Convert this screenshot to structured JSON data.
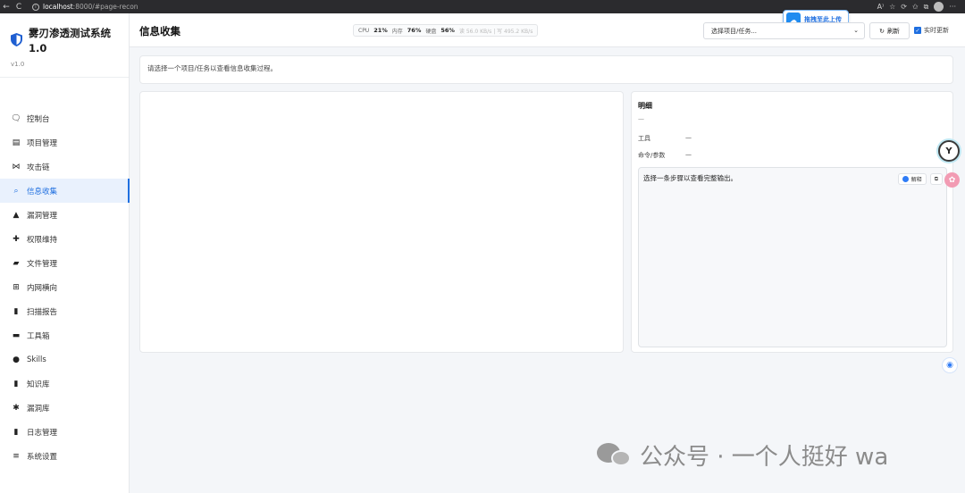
{
  "browser": {
    "url_host": "localhost",
    "url_path": ":8000/#page-recon",
    "back": "←",
    "reload": "C"
  },
  "brand": {
    "title": "雾刃渗透测试系统 1.0",
    "version": "v1.0"
  },
  "menu": [
    {
      "label": "控制台",
      "icon": "chat-icon",
      "glyph": "🗨"
    },
    {
      "label": "项目管理",
      "icon": "tree-icon",
      "glyph": "▤"
    },
    {
      "label": "攻击链",
      "icon": "chain-icon",
      "glyph": "⋈"
    },
    {
      "label": "信息收集",
      "icon": "search-icon",
      "glyph": "⌕",
      "active": true
    },
    {
      "label": "漏洞管理",
      "icon": "warning-icon",
      "glyph": "▲"
    },
    {
      "label": "权限维持",
      "icon": "pin-icon",
      "glyph": "✚"
    },
    {
      "label": "文件管理",
      "icon": "folder-icon",
      "glyph": "▰"
    },
    {
      "label": "内网横向",
      "icon": "network-icon",
      "glyph": "⊞"
    },
    {
      "label": "扫描报告",
      "icon": "file-icon",
      "glyph": "▮"
    },
    {
      "label": "工具箱",
      "icon": "toolbox-icon",
      "glyph": "▬"
    },
    {
      "label": "Skills",
      "icon": "brain-icon",
      "glyph": "●"
    },
    {
      "label": "知识库",
      "icon": "book-icon",
      "glyph": "▮"
    },
    {
      "label": "漏洞库",
      "icon": "bug-icon",
      "glyph": "✱"
    },
    {
      "label": "日志管理",
      "icon": "clipboard-icon",
      "glyph": "▮"
    },
    {
      "label": "系统设置",
      "icon": "sliders-icon",
      "glyph": "≡"
    }
  ],
  "header": {
    "title": "信息收集",
    "sysinfo": {
      "cpu_label": "CPU",
      "cpu_value": "21%",
      "mem_label": "内存",
      "mem_value": "76%",
      "disk_label": "硬盘",
      "disk_value": "56%",
      "io": "读 56.0 KB/s | 写 495.2 KB/s"
    },
    "project_select": "选择项目/任务...",
    "refresh_label": "刷新",
    "realtime_label": "实时更新",
    "upload_label": "拖拽至此上传"
  },
  "hint": "请选择一个项目/任务以查看信息收集过程。",
  "detail": {
    "title": "明细",
    "dash": "—",
    "tool_label": "工具",
    "tool_value": "—",
    "cmd_label": "命令/参数",
    "cmd_value": "—",
    "output_text": "选择一条步骤以查看完整输出。",
    "explain_label": "解释",
    "copy_glyph": "⧉"
  },
  "watermark": "公众号 · 一个人挺好 wa"
}
